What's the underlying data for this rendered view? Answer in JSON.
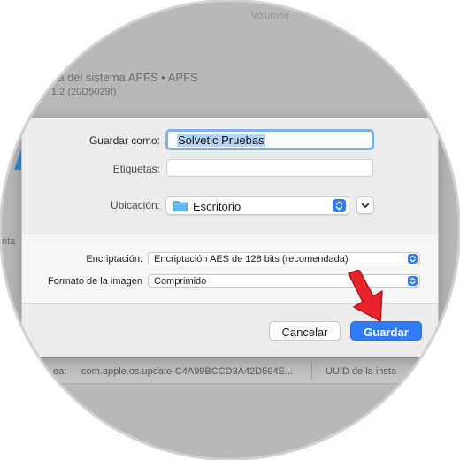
{
  "background": {
    "title_fragment": "c",
    "subtitle": "ea del sistema APFS • APFS",
    "version": "1.2 (20D5029f)",
    "volume_label": "Volumen",
    "left_fragment": "nta",
    "bottom_strip": {
      "label_fragment": "ea:",
      "identifier": "com.apple.os.update-C4A99BCCD3A42D594E...",
      "uuid_label": "UUID de la insta"
    }
  },
  "dialog": {
    "save_as_label": "Guardar como:",
    "save_as_value": "Solvetic Pruebas",
    "tags_label": "Etiquetas:",
    "tags_value": "",
    "location_label": "Ubicación:",
    "location_value": "Escritorio",
    "location_icon": "folder-icon",
    "encryption_label": "Encriptación:",
    "encryption_value": "Encriptación AES de 128 bits (recomendada)",
    "format_label": "Formato de la imagen",
    "format_value": "Comprimido",
    "cancel_label": "Cancelar",
    "save_label": "Guardar"
  },
  "colors": {
    "accent": "#2f7cf6",
    "focus_ring": "#7fb0e8",
    "annotation_arrow": "#e8242a"
  }
}
